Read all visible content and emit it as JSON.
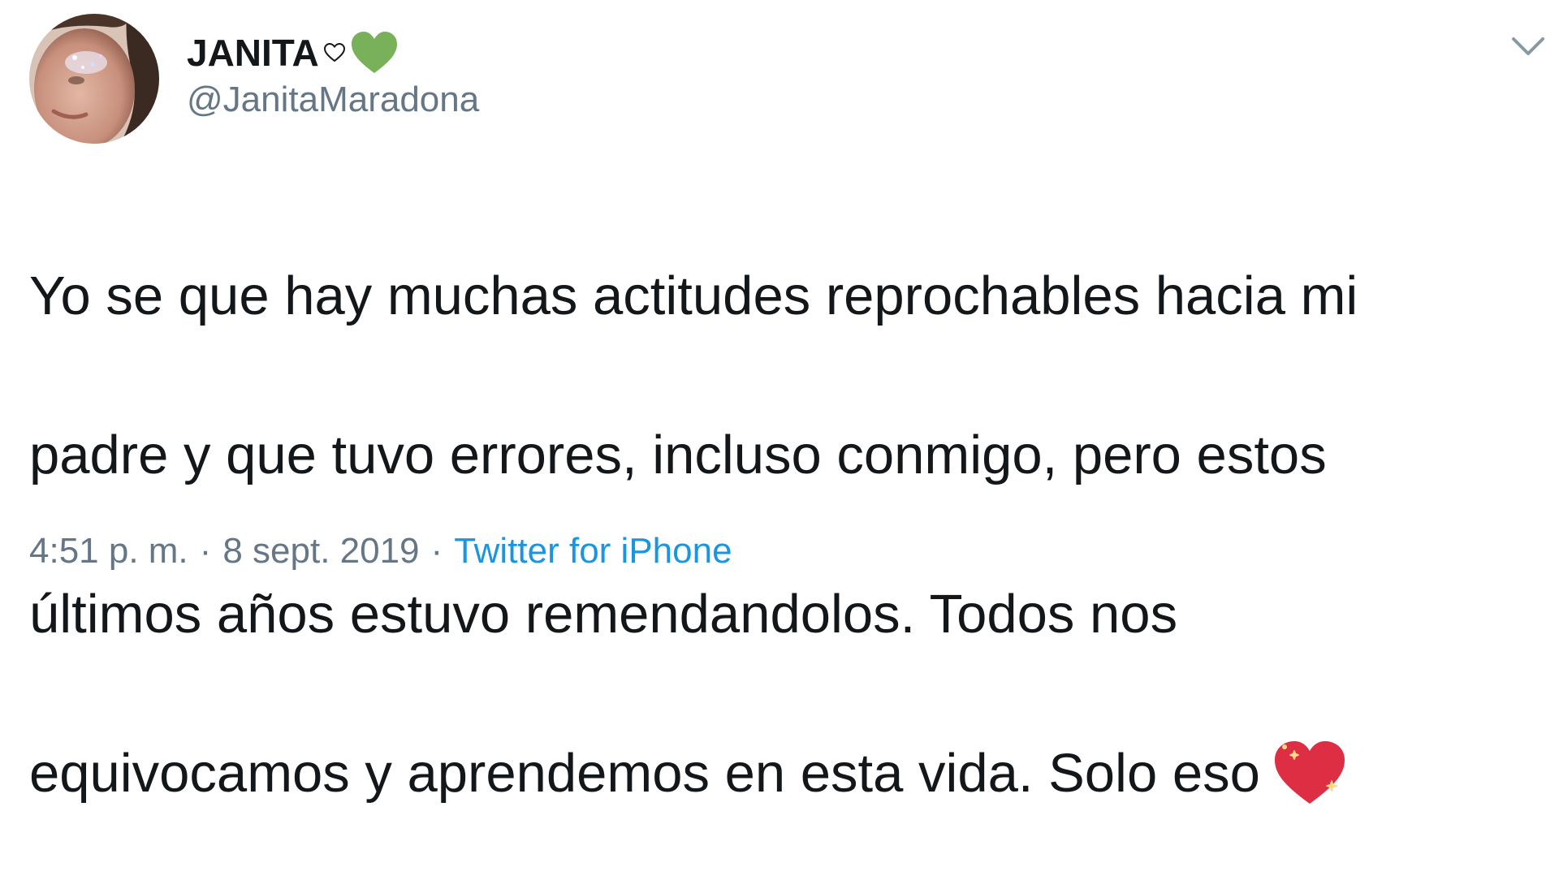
{
  "author": {
    "display_name": "JANITA",
    "name_emojis": [
      "white-heart-icon",
      "green-heart-icon"
    ],
    "handle": "@JanitaMaradona"
  },
  "tweet": {
    "lines": [
      "Yo se que hay muchas actitudes reprochables hacia mi",
      "padre y que tuvo errores, incluso conmigo, pero estos",
      "últimos años estuvo remendandolos. Todos nos",
      "equivocamos y aprendemos en esta vida. Solo eso"
    ],
    "trailing_emoji": "sparkling-heart-icon"
  },
  "meta": {
    "time": "4:51 p. m.",
    "separator": "·",
    "date": "8 sept. 2019",
    "source": "Twitter for iPhone"
  },
  "colors": {
    "text": "#14171a",
    "secondary": "#657786",
    "link": "#1b95e0",
    "green_heart": "#78b159",
    "sparkling_heart": "#dd2e44"
  }
}
